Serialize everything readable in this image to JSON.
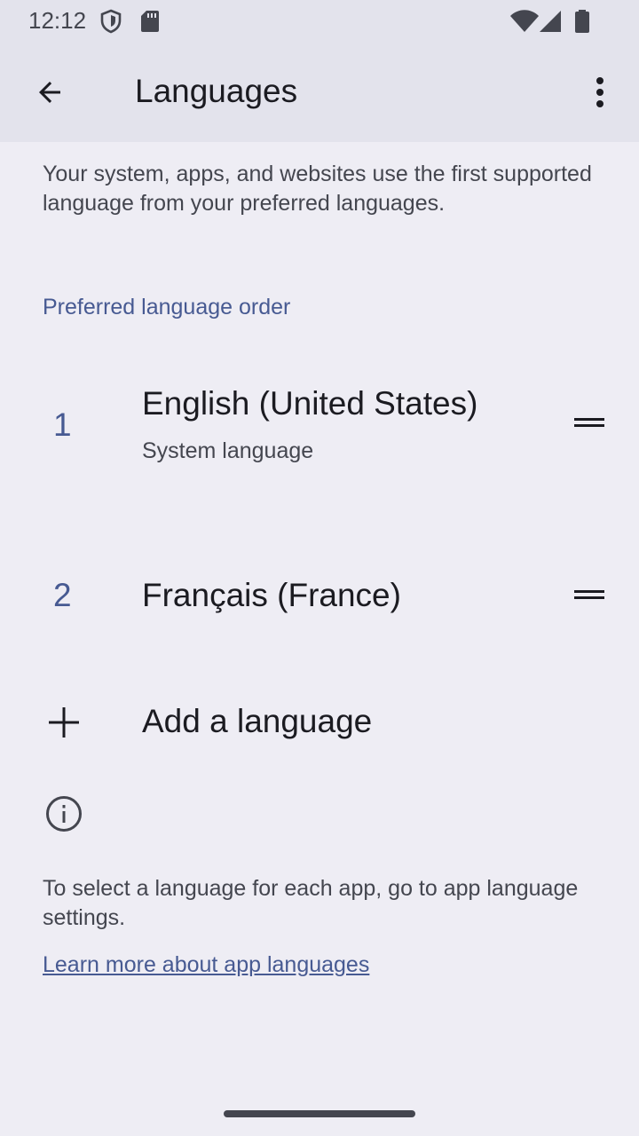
{
  "status_bar": {
    "time": "12:12",
    "icons": [
      "shield-icon",
      "sd-card-icon",
      "wifi-icon",
      "signal-icon",
      "battery-icon"
    ]
  },
  "app_bar": {
    "title": "Languages",
    "back_icon": "arrow-back-icon",
    "more_icon": "more-vert-icon"
  },
  "description": "Your system, apps, and websites use the first supported language from your preferred languages.",
  "section_header": "Preferred language order",
  "languages": [
    {
      "number": "1",
      "name": "English (United States)",
      "subtitle": "System language"
    },
    {
      "number": "2",
      "name": "Français (France)",
      "subtitle": ""
    }
  ],
  "add_language": {
    "label": "Add a language",
    "icon": "plus-icon"
  },
  "footer": {
    "info_icon": "info-icon",
    "text": "To select a language for each app, go to app language settings.",
    "link": "Learn more about app languages"
  },
  "colors": {
    "background": "#eeedf4",
    "app_bar": "#e3e3ec",
    "accent": "#475a92",
    "text_primary": "#1b1b21",
    "text_secondary": "#44464f"
  }
}
